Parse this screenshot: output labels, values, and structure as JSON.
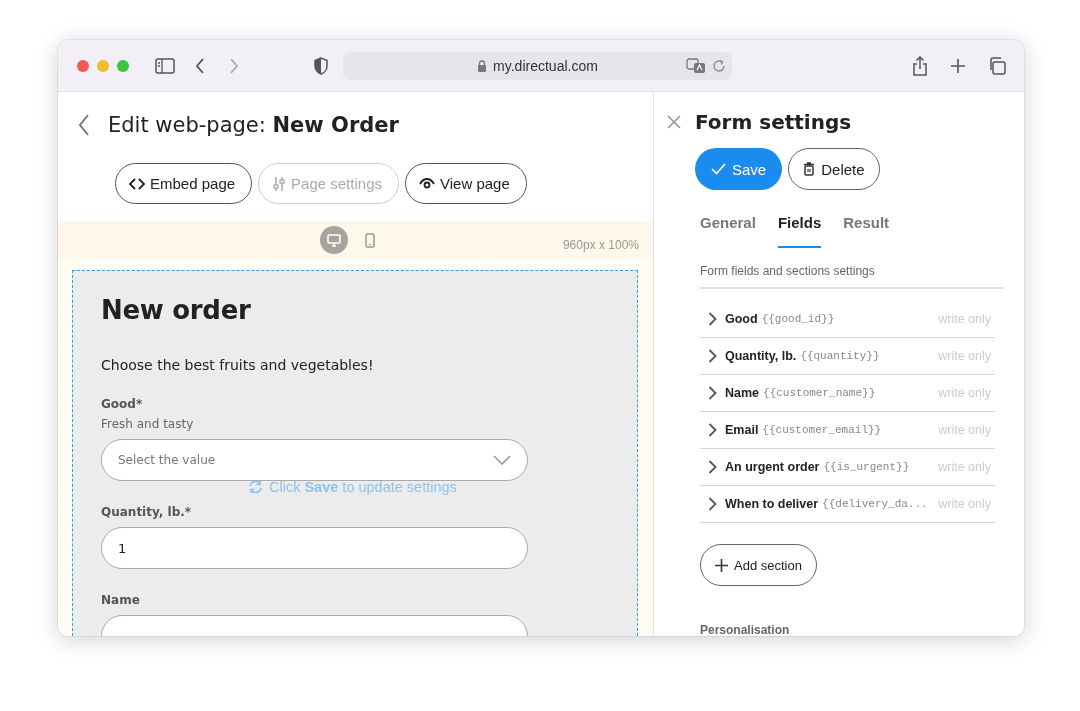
{
  "browser": {
    "address": "my.directual.com"
  },
  "editor": {
    "title": "Edit web-page: **New Order**",
    "toolbar": [
      {
        "kind": "code",
        "label": "Embed page",
        "disabled": false
      },
      {
        "kind": "sliders",
        "label": "Page settings",
        "disabled": true
      },
      {
        "kind": "eye",
        "label": "View page",
        "disabled": false
      }
    ],
    "devices": [
      {
        "kind": "desktop",
        "selected": true
      },
      {
        "kind": "mobile",
        "selected": false
      }
    ],
    "canvas_size": "960px x 100%",
    "form": {
      "title": "New order",
      "intro": "Choose the best fruits and vegetables!",
      "fields": [
        {
          "kind": "select",
          "label": "Good*",
          "hint": "Fresh and tasty",
          "placeholder": "Select the value"
        },
        {
          "kind": "text",
          "label": "Quantity, lb.*",
          "value": "1"
        },
        {
          "kind": "text",
          "label": "Name"
        }
      ]
    },
    "notice": "Click **Save** to update settings"
  },
  "panel": {
    "title": "Form settings",
    "actions": [
      {
        "kind": "primary",
        "label": "Save"
      },
      {
        "kind": "delete",
        "label": "Delete"
      }
    ],
    "tabs": [
      {
        "label": "General",
        "selected": false
      },
      {
        "label": "Fields",
        "selected": true
      },
      {
        "label": "Result",
        "selected": false
      }
    ],
    "section_title": "Form fields and sections settings",
    "fields": [
      {
        "name": "Good",
        "variable": "{{good_id}}",
        "access": "write only"
      },
      {
        "name": "Quantity, lb.",
        "variable": "{{quantity}}",
        "access": "write only"
      },
      {
        "name": "Name",
        "variable": "{{customer_name}}",
        "access": "write only"
      },
      {
        "name": "Email",
        "variable": "{{customer_email}}",
        "access": "write only"
      },
      {
        "name": "An urgent order",
        "variable": "{{is_urgent}}",
        "access": "write only"
      },
      {
        "name": "When to deliver",
        "variable": "{{delivery_da...",
        "access": "write only"
      }
    ],
    "add_button": "Add section",
    "next_section": "Personalisation"
  }
}
